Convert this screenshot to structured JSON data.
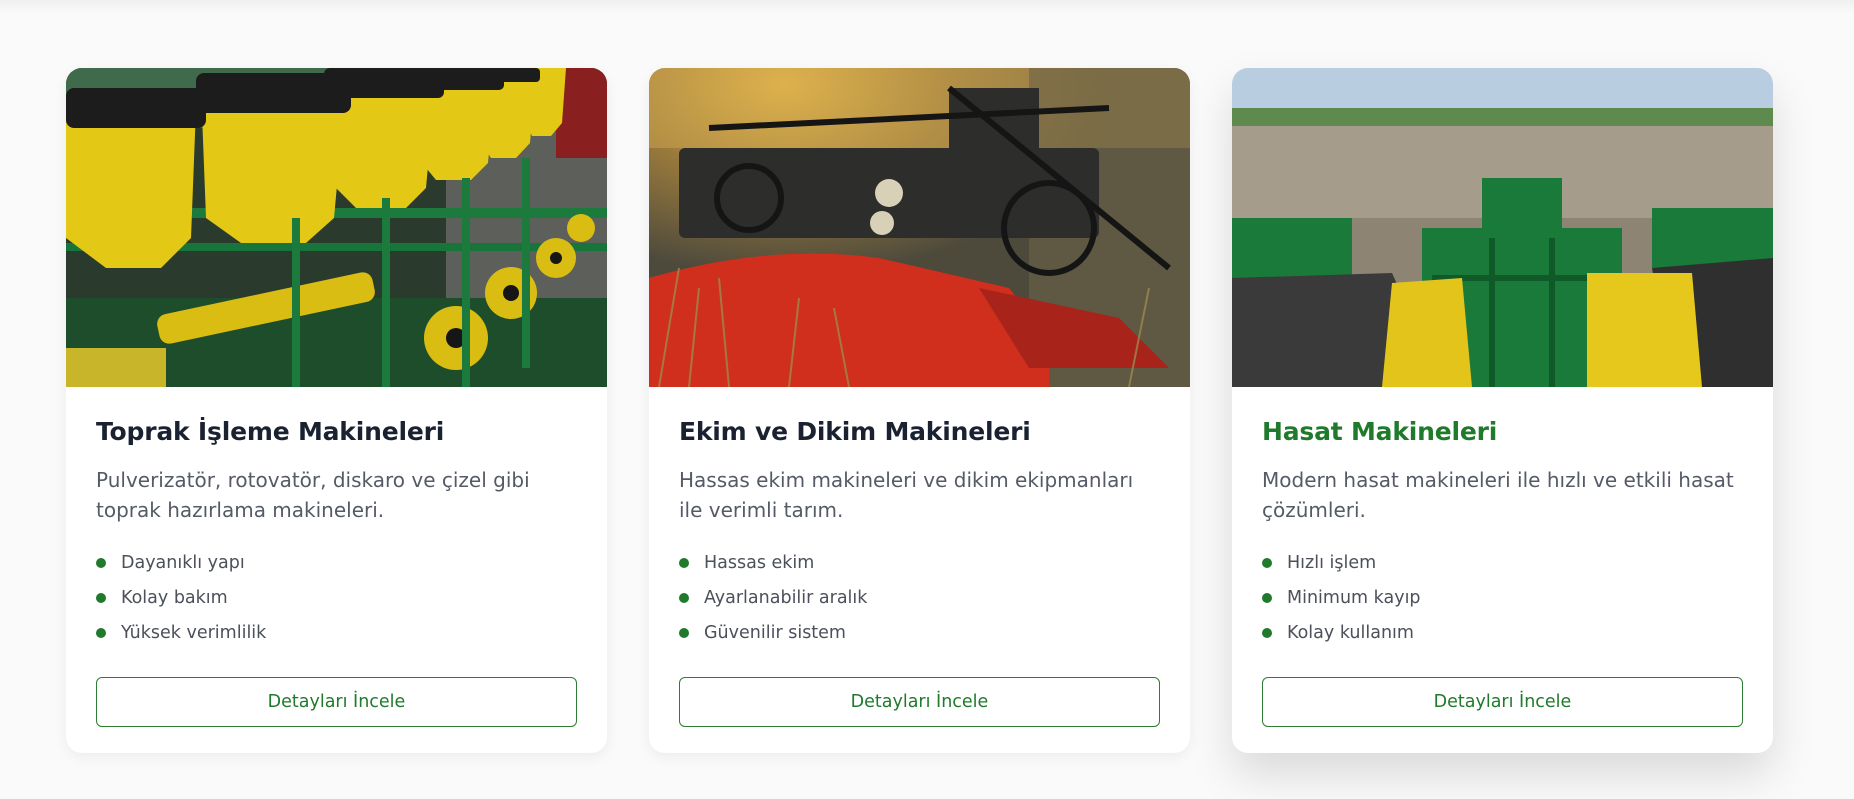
{
  "cards": [
    {
      "title": "Toprak İşleme Makineleri",
      "description": "Pulverizatör, rotovatör, diskaro ve çizel gibi toprak hazırlama makineleri.",
      "features": [
        "Dayanıklı yapı",
        "Kolay bakım",
        "Yüksek verimlilik"
      ],
      "button_label": "Detayları İncele",
      "image": "seed-planter-machinery-photo"
    },
    {
      "title": "Ekim ve Dikim Makineleri",
      "description": "Hassas ekim makineleri ve dikim ekipmanları ile verimli tarım.",
      "features": [
        "Hassas ekim",
        "Ayarlanabilir aralık",
        "Güvenilir sistem"
      ],
      "button_label": "Detayları İncele",
      "image": "harvester-header-photo"
    },
    {
      "title": "Hasat Makineleri",
      "description": "Modern hasat makineleri ile hızlı ve etkili hasat çözümleri.",
      "features": [
        "Hızlı işlem",
        "Minimum kayıp",
        "Kolay kullanım"
      ],
      "button_label": "Detayları İncele",
      "image": "field-planter-photo"
    }
  ],
  "colors": {
    "accent": "#1f7a2b",
    "title": "#1a2231",
    "text": "#555b66",
    "background": "#fafafa"
  }
}
